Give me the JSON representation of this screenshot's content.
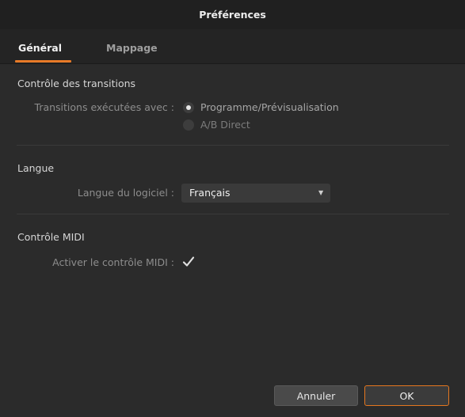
{
  "window": {
    "title": "Préférences"
  },
  "tabs": [
    {
      "label": "Général",
      "active": true
    },
    {
      "label": "Mappage",
      "active": false
    }
  ],
  "transitions": {
    "section_title": "Contrôle des transitions",
    "field_label": "Transitions exécutées avec :",
    "options": [
      {
        "label": "Programme/Prévisualisation",
        "selected": true
      },
      {
        "label": "A/B Direct",
        "selected": false
      }
    ]
  },
  "language": {
    "section_title": "Langue",
    "field_label": "Langue du logiciel :",
    "selected_value": "Français"
  },
  "midi": {
    "section_title": "Contrôle MIDI",
    "field_label": "Activer le contrôle MIDI :",
    "enabled": true
  },
  "buttons": {
    "cancel": "Annuler",
    "ok": "OK"
  },
  "colors": {
    "accent": "#e77a28",
    "background": "#2b2b2b",
    "titlebar": "#202020"
  }
}
